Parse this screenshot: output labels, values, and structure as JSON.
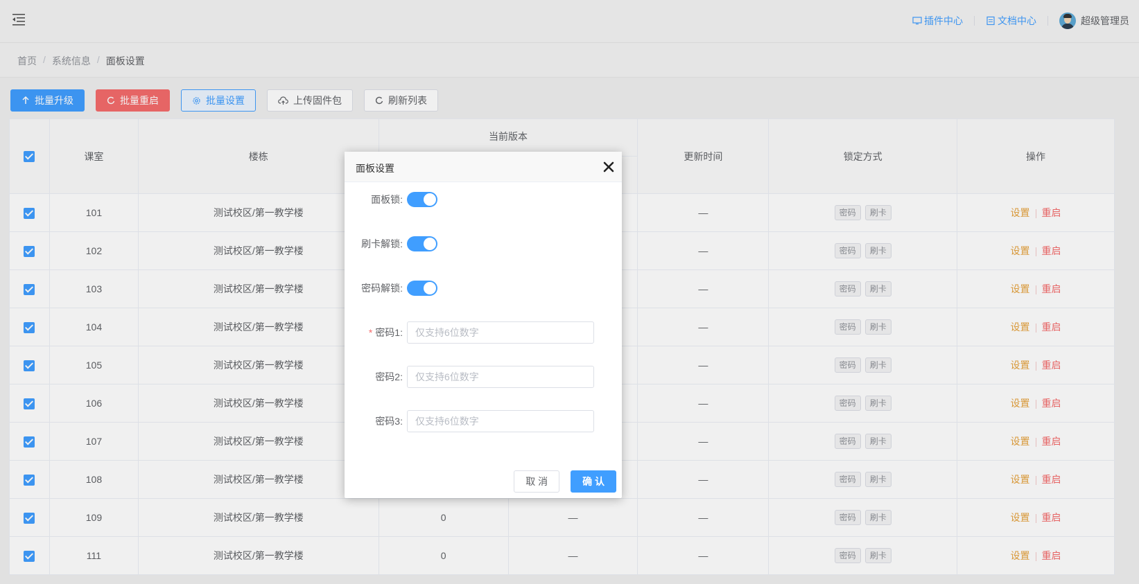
{
  "header": {
    "plugin_center": "插件中心",
    "doc_center": "文档中心",
    "user_name": "超级管理员"
  },
  "breadcrumb": [
    "首页",
    "系统信息",
    "面板设置"
  ],
  "toolbar": {
    "batch_upgrade": "批量升级",
    "batch_restart": "批量重启",
    "batch_settings": "批量设置",
    "upload_firmware": "上传固件包",
    "refresh_list": "刷新列表"
  },
  "table": {
    "columns": {
      "classroom": "课室",
      "building": "楼栋",
      "current_version": "当前版本",
      "update_time": "更新时间",
      "lock_mode": "锁定方式",
      "actions": "操作"
    },
    "tag_password": "密码",
    "tag_card": "刷卡",
    "action_settings": "设置",
    "action_restart": "重启",
    "rows": [
      {
        "room": "101",
        "building": "测试校区/第一教学楼",
        "v1": "",
        "v2": "",
        "time": "—"
      },
      {
        "room": "102",
        "building": "测试校区/第一教学楼",
        "v1": "",
        "v2": "",
        "time": "—"
      },
      {
        "room": "103",
        "building": "测试校区/第一教学楼",
        "v1": "",
        "v2": "",
        "time": "—"
      },
      {
        "room": "104",
        "building": "测试校区/第一教学楼",
        "v1": "",
        "v2": "",
        "time": "—"
      },
      {
        "room": "105",
        "building": "测试校区/第一教学楼",
        "v1": "",
        "v2": "",
        "time": "—"
      },
      {
        "room": "106",
        "building": "测试校区/第一教学楼",
        "v1": "",
        "v2": "",
        "time": "—"
      },
      {
        "room": "107",
        "building": "测试校区/第一教学楼",
        "v1": "",
        "v2": "",
        "time": "—"
      },
      {
        "room": "108",
        "building": "测试校区/第一教学楼",
        "v1": "",
        "v2": "",
        "time": "—"
      },
      {
        "room": "109",
        "building": "测试校区/第一教学楼",
        "v1": "0",
        "v2": "—",
        "time": "—"
      },
      {
        "room": "111",
        "building": "测试校区/第一教学楼",
        "v1": "0",
        "v2": "—",
        "time": "—"
      }
    ]
  },
  "modal": {
    "title": "面板设置",
    "panel_lock_label": "面板锁:",
    "card_unlock_label": "刷卡解锁:",
    "password_unlock_label": "密码解锁:",
    "required_mark": "*",
    "password1_label": "密码1:",
    "password2_label": "密码2:",
    "password3_label": "密码3:",
    "password_placeholder": "仅支持6位数字",
    "panel_lock_on": true,
    "card_unlock_on": true,
    "password_unlock_on": true,
    "cancel": "取 消",
    "confirm": "确 认"
  },
  "colors": {
    "primary": "#409eff",
    "danger": "#f56c6c",
    "warning": "#e6a23c"
  }
}
